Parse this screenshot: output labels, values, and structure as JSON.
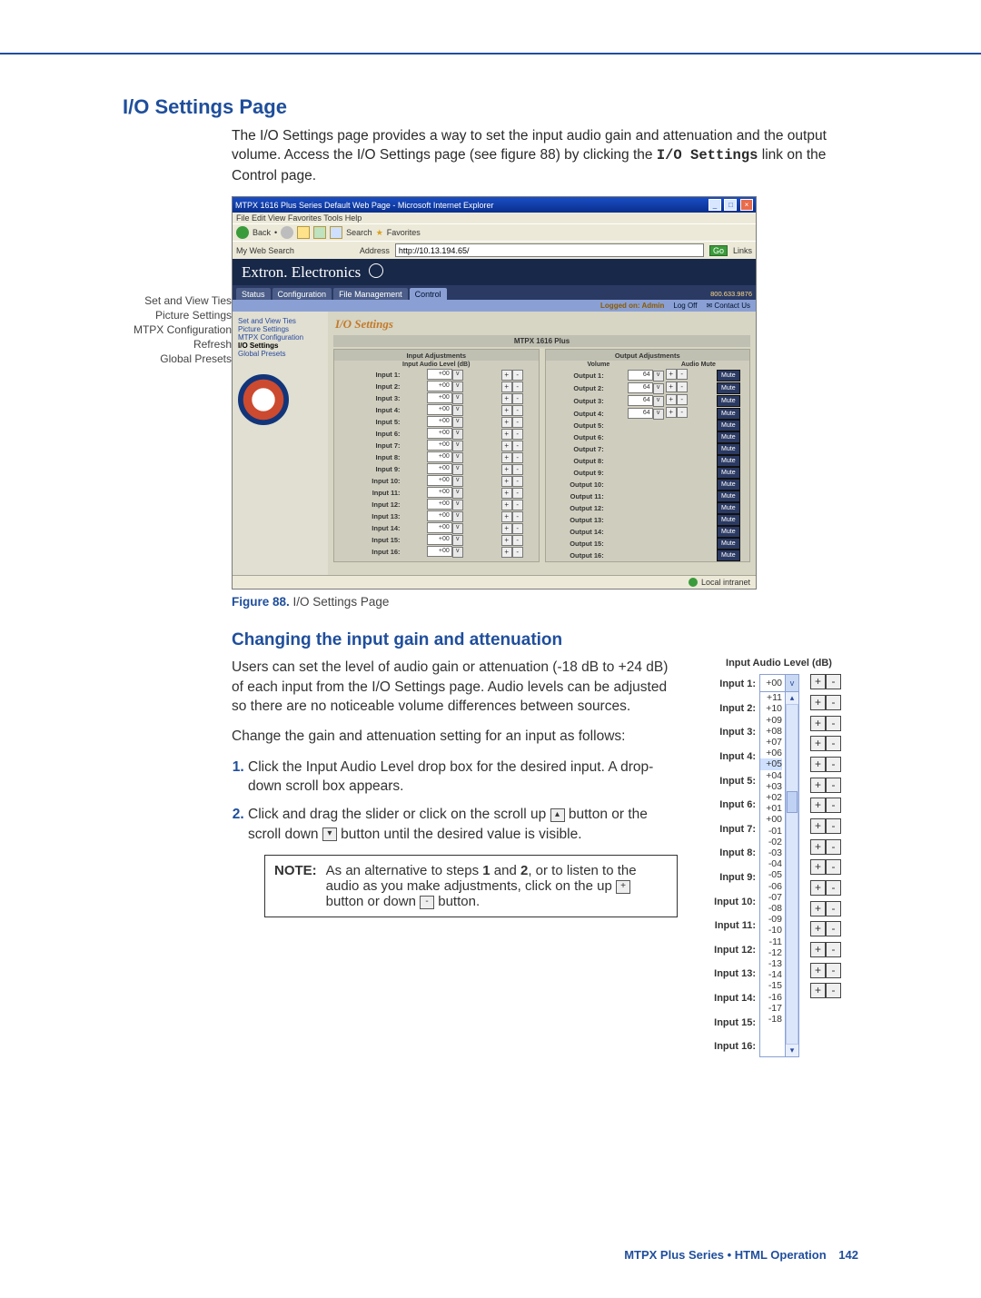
{
  "page": {
    "h1": "I/O Settings Page",
    "intro": "The I/O Settings page provides a way to set the input audio gain and attenuation and the output volume. Access the I/O Settings page (see figure 88) by clicking the ",
    "intro_code": "I/O Settings",
    "intro_tail": " link on the Control page.",
    "caption_fig": "Figure 88.",
    "caption_txt": " I/O Settings Page",
    "h2": "Changing the input gain and attenuation",
    "para2": "Users can set the level of audio gain or attenuation (-18 dB to +24 dB) of each input from the I/O Settings page. Audio levels can be adjusted so there are no noticeable volume differences between sources.",
    "para3": "Change the gain and attenuation setting for an input as follows:",
    "step1": "Click the Input Audio Level drop box for the desired input. A drop-down scroll box appears.",
    "step2a": "Click and drag the slider or click on the scroll up ",
    "step2b": " button or the scroll down ",
    "step2c": " button until the desired value is visible.",
    "note_h": "NOTE:",
    "note_a": "As an alternative to steps ",
    "note_b1": "1",
    "note_mid": " and ",
    "note_b2": "2",
    "note_c": ", or to listen to the audio as you make adjustments, click on the up ",
    "note_d": " button or down ",
    "note_e": " button.",
    "footer": "MTPX Plus Series • HTML Operation",
    "footer_pn": "142"
  },
  "callouts": [
    "Set and View Ties",
    "Picture Settings",
    "MTPX Configuration",
    "Refresh",
    "Global Presets"
  ],
  "ie": {
    "title": "MTPX 1616 Plus Series Default Web Page - Microsoft Internet Explorer",
    "menu": "File   Edit   View   Favorites   Tools   Help",
    "back": "Back",
    "searchbtn": "Search",
    "favorites": "Favorites",
    "my_web": "My Web Search",
    "addr_label": "Address",
    "addr_value": "http://10.13.194.65/",
    "go": "Go",
    "links": "Links",
    "status": "Local intranet"
  },
  "extron": {
    "brand": "Extron. Electronics",
    "tabs": [
      "Status",
      "Configuration",
      "File Management",
      "Control"
    ],
    "active_tab": 3,
    "logged": "Logged on: Admin",
    "logoff": "Log Off",
    "phone": "800.633.9876",
    "contact": "Contact Us",
    "side_links": [
      "Set and View Ties",
      "Picture Settings",
      "MTPX Configuration",
      "I/O Settings",
      "Global Presets"
    ],
    "side_active": 3,
    "page_title": "I/O Settings",
    "device": "MTPX 1616 Plus",
    "panel_in_h": "Input Adjustments",
    "panel_in_sub": "Input Audio Level (dB)",
    "panel_out_h": "Output Adjustments",
    "panel_out_vol": "Volume",
    "panel_out_mute": "Audio Mute",
    "mute_label": "Mute",
    "inputs": [
      {
        "label": "Input 1:",
        "level": "+00"
      },
      {
        "label": "Input 2:",
        "level": "+00"
      },
      {
        "label": "Input 3:",
        "level": "+00"
      },
      {
        "label": "Input 4:",
        "level": "+00"
      },
      {
        "label": "Input 5:",
        "level": "+00"
      },
      {
        "label": "Input 6:",
        "level": "+00"
      },
      {
        "label": "Input 7:",
        "level": "+00"
      },
      {
        "label": "Input 8:",
        "level": "+00"
      },
      {
        "label": "Input 9:",
        "level": "+00"
      },
      {
        "label": "Input 10:",
        "level": "+00"
      },
      {
        "label": "Input 11:",
        "level": "+00"
      },
      {
        "label": "Input 12:",
        "level": "+00"
      },
      {
        "label": "Input 13:",
        "level": "+00"
      },
      {
        "label": "Input 14:",
        "level": "+00"
      },
      {
        "label": "Input 15:",
        "level": "+00"
      },
      {
        "label": "Input 16:",
        "level": "+00"
      }
    ],
    "outputs": [
      {
        "label": "Output 1:",
        "vol": "64",
        "has_vol": true
      },
      {
        "label": "Output 2:",
        "vol": "64",
        "has_vol": true
      },
      {
        "label": "Output 3:",
        "vol": "64",
        "has_vol": true
      },
      {
        "label": "Output 4:",
        "vol": "64",
        "has_vol": true
      },
      {
        "label": "Output 5:",
        "has_vol": false
      },
      {
        "label": "Output 6:",
        "has_vol": false
      },
      {
        "label": "Output 7:",
        "has_vol": false
      },
      {
        "label": "Output 8:",
        "has_vol": false
      },
      {
        "label": "Output 9:",
        "has_vol": false
      },
      {
        "label": "Output 10:",
        "has_vol": false
      },
      {
        "label": "Output 11:",
        "has_vol": false
      },
      {
        "label": "Output 12:",
        "has_vol": false
      },
      {
        "label": "Output 13:",
        "has_vol": false
      },
      {
        "label": "Output 14:",
        "has_vol": false
      },
      {
        "label": "Output 15:",
        "has_vol": false
      },
      {
        "label": "Output 16:",
        "has_vol": false
      }
    ]
  },
  "rfig": {
    "title": "Input Audio Level (dB)",
    "labels": [
      "Input 1:",
      "Input 2:",
      "Input 3:",
      "Input 4:",
      "Input 5:",
      "Input 6:",
      "Input 7:",
      "Input 8:",
      "Input 9:",
      "Input 10:",
      "Input 11:",
      "Input 12:",
      "Input 13:",
      "Input 14:",
      "Input 15:",
      "Input 16:"
    ],
    "selected_top": "+00",
    "options": [
      "+11",
      "+10",
      "+09",
      "+08",
      "+07",
      "+06",
      "+05",
      "+04",
      "+03",
      "+02",
      "+01",
      "+00",
      "-01",
      "-02",
      "-03",
      "-04",
      "-05",
      "-06",
      "-07",
      "-08",
      "-09",
      "-10",
      "-11",
      "-12",
      "-13",
      "-14",
      "-15",
      "-16",
      "-17",
      "-18"
    ],
    "selected_value": "+05"
  },
  "glyph": {
    "plus": "+",
    "minus": "-",
    "up": "▴",
    "down": "▾",
    "caret": "v"
  }
}
